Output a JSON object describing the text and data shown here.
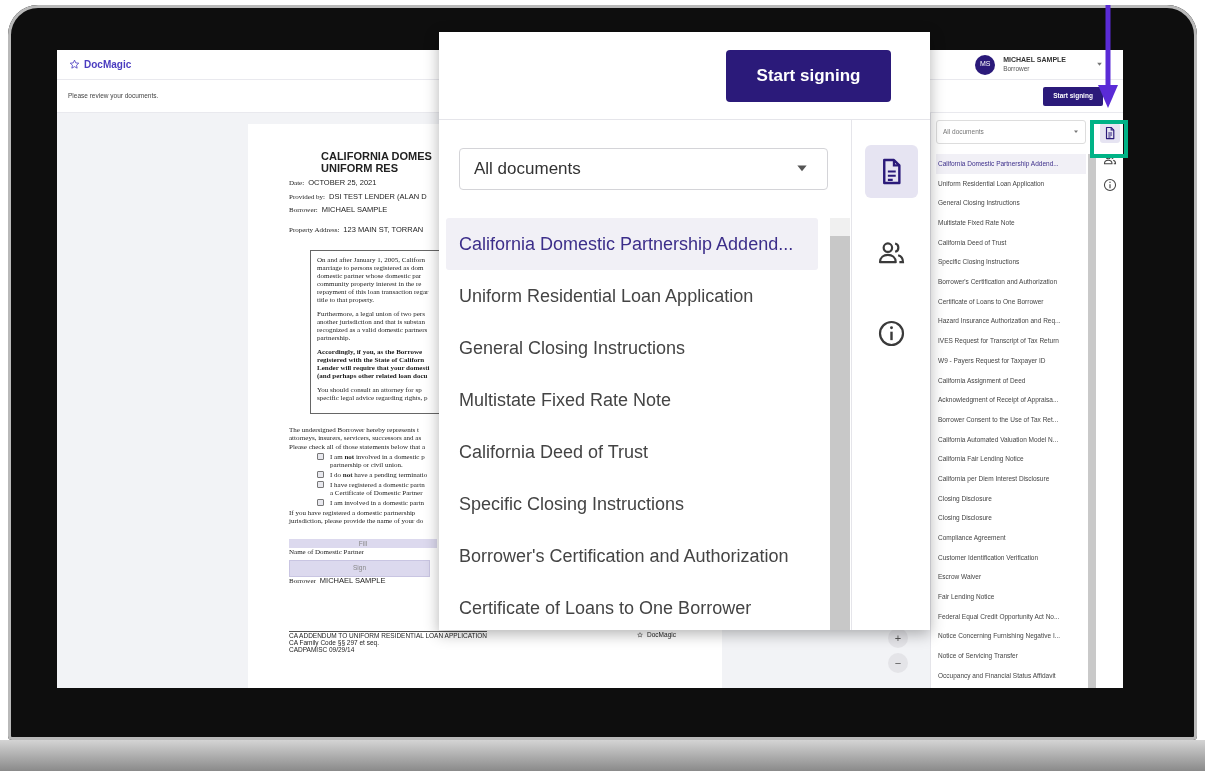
{
  "header": {
    "logo_text": "DocMagic",
    "user": {
      "initials": "MS",
      "name": "MICHAEL SAMPLE",
      "role": "Borrower"
    }
  },
  "toolbar": {
    "message": "Please review your documents.",
    "button": "Start signing"
  },
  "document": {
    "title_lines": [
      "CALIFORNIA DOMES",
      "UNIFORM RES"
    ],
    "fields": [
      {
        "label": "Date:",
        "value": "OCTOBER 25, 2021"
      },
      {
        "label": "Provided by:",
        "value": "DSI TEST LENDER (ALAN D"
      },
      {
        "label": "Borrower:",
        "value": "MICHAEL SAMPLE"
      },
      {
        "label": "Property Address:",
        "value": "123 MAIN ST, TORRAN"
      }
    ],
    "notice_paragraphs": [
      {
        "bold": false,
        "lines": [
          "On and after January 1, 2005, Californ",
          "marriage to persons registered as dom",
          "domestic partner whose domestic par",
          "community property interest in the re",
          "repayment of this loan transaction regar",
          "title to that property."
        ]
      },
      {
        "bold": false,
        "lines": [
          "Furthermore, a legal union of two pers",
          "another jurisdiction and that is substan",
          "recognized as a valid domestic partners",
          "partnership."
        ]
      },
      {
        "bold": true,
        "lines": [
          "Accordingly, if you, as the Borrowe",
          "registered with the State of Californ",
          "Lender will require that your domesti",
          "(and perhaps other related loan docu"
        ]
      },
      {
        "bold": false,
        "lines": [
          "You should consult an attorney for sp",
          "specific legal advice regarding rights, p"
        ]
      }
    ],
    "intro_lines": [
      "The undersigned Borrower hereby represents t",
      "attorneys, insurers, servicers, successors and as"
    ],
    "check_prompt": "Please check all of those statements below that a",
    "statements": [
      {
        "checked": false,
        "lines": [
          "I am **not** involved in a domestic p",
          "partnership or civil union."
        ]
      },
      {
        "checked": false,
        "lines": [
          "I do **not** have a pending terminatio"
        ]
      },
      {
        "checked": false,
        "lines": [
          "I have registered a domestic partn",
          "a Certificate of Domestic Partner"
        ]
      },
      {
        "checked": false,
        "lines": [
          "I am involved in a domestic partn"
        ]
      }
    ],
    "partner_prompt_lines": [
      "If you have registered a domestic partnership",
      "jurisdiction, please provide the name of your do"
    ],
    "fill_field": {
      "placeholder": "Fill"
    },
    "fill_label": "Name of Domestic Partner",
    "sign_button": "Sign",
    "signer": {
      "label": "Borrower",
      "value": "MICHAEL SAMPLE"
    },
    "footer_lines": [
      "CA ADDENDUM TO UNIFORM RESIDENTIAL LOAN APPLICATION",
      "CA Family Code §§ 297 et seq.",
      "CADPAMISC  09/29/14"
    ],
    "footer_brand": "DocMagic"
  },
  "zoom_controls": [
    "+",
    "−"
  ],
  "documents_panel": {
    "filter": "All documents",
    "items": [
      {
        "label": "California Domestic Partnership Addend...",
        "selected": true
      },
      {
        "label": "Uniform Residential Loan Application",
        "selected": false
      },
      {
        "label": "General Closing Instructions",
        "selected": false
      },
      {
        "label": "Multistate Fixed Rate Note",
        "selected": false
      },
      {
        "label": "California Deed of Trust",
        "selected": false
      },
      {
        "label": "Specific Closing Instructions",
        "selected": false
      },
      {
        "label": "Borrower's Certification and Authorization",
        "selected": false
      },
      {
        "label": "Certificate of Loans to One Borrower",
        "selected": false
      },
      {
        "label": "Hazard Insurance Authorization and Req...",
        "selected": false
      },
      {
        "label": "IVES Request for Transcript of Tax Return",
        "selected": false
      },
      {
        "label": "W9 - Payers Request for Taxpayer ID",
        "selected": false
      },
      {
        "label": "California Assignment of Deed",
        "selected": false
      },
      {
        "label": "Acknowledgment of Receipt of Appraisa...",
        "selected": false
      },
      {
        "label": "Borrower Consent to the Use of Tax Ret...",
        "selected": false
      },
      {
        "label": "California Automated Valuation Model N...",
        "selected": false
      },
      {
        "label": "California Fair Lending Notice",
        "selected": false
      },
      {
        "label": "California per Diem Interest Disclosure",
        "selected": false
      },
      {
        "label": "Closing Disclosure",
        "selected": false
      },
      {
        "label": "Closing Disclosure",
        "selected": false
      },
      {
        "label": "Compliance Agreement",
        "selected": false
      },
      {
        "label": "Customer Identification Verification",
        "selected": false
      },
      {
        "label": "Escrow Waiver",
        "selected": false
      },
      {
        "label": "Fair Lending Notice",
        "selected": false
      },
      {
        "label": "Federal Equal Credit Opportunity Act No...",
        "selected": false
      },
      {
        "label": "Notice Concerning Furnishing Negative I...",
        "selected": false
      },
      {
        "label": "Notice of Servicing Transfer",
        "selected": false
      },
      {
        "label": "Occupancy and Financial Status Affidavit",
        "selected": false
      }
    ]
  },
  "side_rail": [
    {
      "kind": "documents",
      "selected": true
    },
    {
      "kind": "people",
      "selected": false
    },
    {
      "kind": "info",
      "selected": false
    }
  ],
  "callout": {
    "button": "Start signing",
    "filter": "All documents",
    "items": [
      {
        "label": "California Domestic Partnership Addend...",
        "selected": true
      },
      {
        "label": "Uniform Residential Loan Application",
        "selected": false
      },
      {
        "label": "General Closing Instructions",
        "selected": false
      },
      {
        "label": "Multistate Fixed Rate Note",
        "selected": false
      },
      {
        "label": "California Deed of Trust",
        "selected": false
      },
      {
        "label": "Specific Closing Instructions",
        "selected": false
      },
      {
        "label": "Borrower's Certification and Authorization",
        "selected": false
      },
      {
        "label": "Certificate of Loans to One Borrower",
        "selected": false
      }
    ],
    "rail": [
      {
        "kind": "documents",
        "selected": true
      },
      {
        "kind": "people",
        "selected": false
      },
      {
        "kind": "info",
        "selected": false
      }
    ]
  }
}
